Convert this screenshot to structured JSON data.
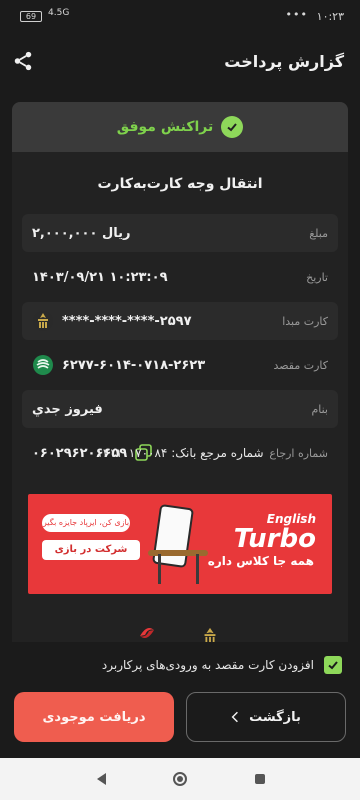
{
  "status_bar": {
    "time": "۱۰:۲۳",
    "battery": "69",
    "signal": "4.5G",
    "dots": "•••"
  },
  "header": {
    "title": "گزارش پرداخت"
  },
  "receipt": {
    "status": "تراکنش موفق",
    "title": "انتقال وجه کارت‌به‌کارت",
    "rows": [
      {
        "key": "مبلغ",
        "value": "۲,۰۰۰,۰۰۰ ریال"
      },
      {
        "key": "تاریخ",
        "value": "۱۴۰۳/۰۹/۲۱ ۱۰:۲۳:۰۹"
      },
      {
        "key": "کارت مبدا",
        "value": "****-****-****-۲۵۹۷"
      },
      {
        "key": "کارت مقصد",
        "value": "۶۲۷۷-۶۰۱۴-۰۷۱۸-۲۶۲۳"
      },
      {
        "key": "بنام",
        "value": "فیروز جدي"
      },
      {
        "key": "شماره ارجاع",
        "value": "۰۶۰۲۹۶۲۰۶۶۵۹"
      }
    ],
    "bank_reference": "شماره مرجع بانک: ۱۲۱۱۰۱۷۰۰۸۴"
  },
  "banner": {
    "brand_en": "English",
    "brand_turbo": "Turbo",
    "slogan": "همه جا کلاس داره",
    "pill_text": "بازی کن، ایرپاد جایزه بگیر",
    "cta": "شرکت در بازی"
  },
  "footer": {
    "checkbox_label": "افزودن کارت مقصد به ورودی‌های پرکاربرد",
    "checkbox_checked": true,
    "back_label": "بازگشت",
    "balance_label": "دریافت موجودی"
  },
  "colors": {
    "success_green": "#8ed85a",
    "accent_red": "#ef5d4f",
    "banner_red": "#e8383a"
  }
}
